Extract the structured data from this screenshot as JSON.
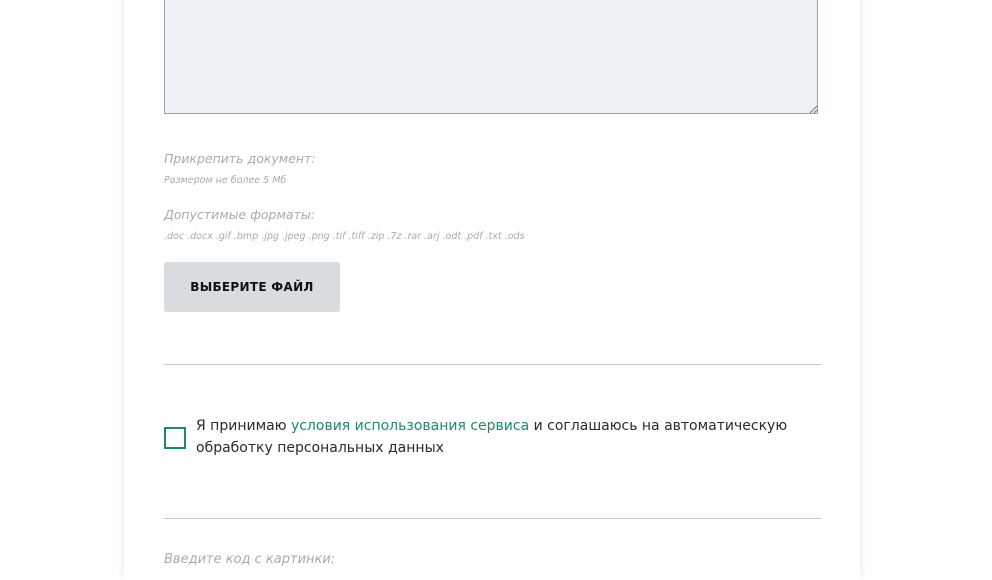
{
  "attachment": {
    "label": "Прикрепить документ:",
    "size_hint": "Размером не более 5 Мб",
    "formats_label": "Допустимые форматы:",
    "formats_list": ".doc .docx .gif .bmp .jpg .jpeg .png .tif .tiff .zip .7z .rar .arj .odt .pdf .txt .ods",
    "choose_file_label": "ВЫБЕРИТЕ ФАЙЛ"
  },
  "consent": {
    "prefix": "Я принимаю ",
    "link_text": "условия использования сервиса",
    "suffix": " и соглашаюсь на автоматическую обработку персональных данных",
    "checked": false
  },
  "captcha": {
    "label": "Введите код с картинки:"
  },
  "colors": {
    "accent": "#1d8a6b",
    "muted_text": "#a6abb0",
    "button_bg": "#d8dcde",
    "textarea_bg": "#eef2f5"
  }
}
